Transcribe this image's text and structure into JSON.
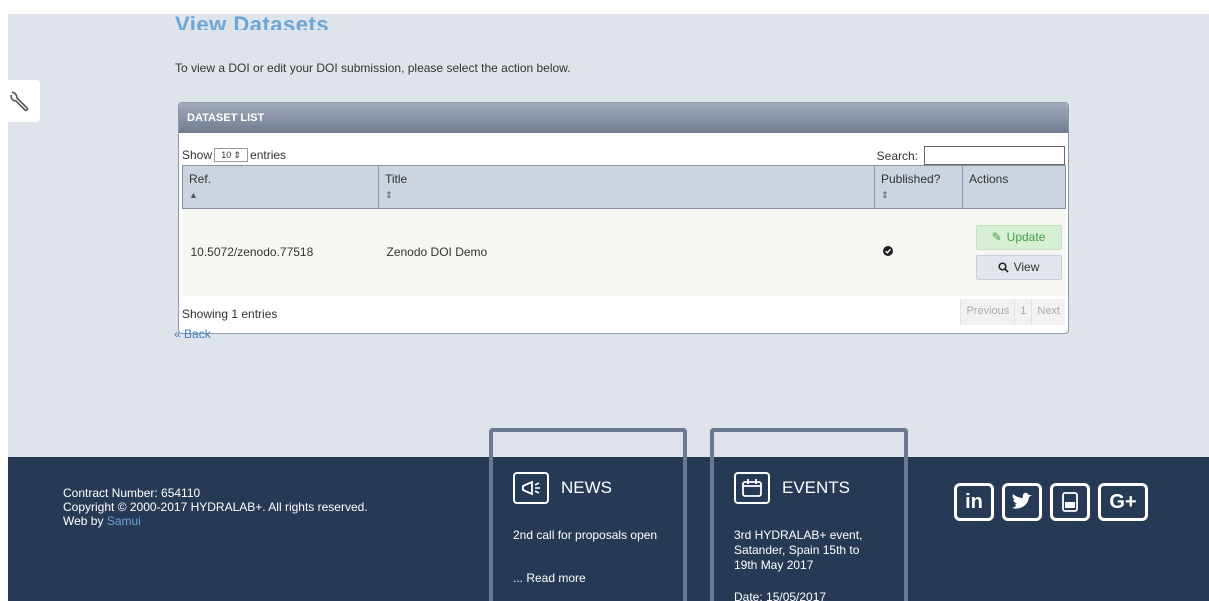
{
  "page": {
    "title": "View Datasets",
    "intro": "To view a DOI or edit your DOI submission, please select the action below."
  },
  "panel": {
    "title": "DATASET LIST",
    "show_label": "Show",
    "entries_label": "entries",
    "length_value": "10",
    "search_label": "Search:",
    "search_value": ""
  },
  "table": {
    "columns": [
      "Ref.",
      "Title",
      "Published?",
      "Actions"
    ],
    "rows": [
      {
        "ref": "10.5072/zenodo.77518",
        "title": "Zenodo DOI Demo",
        "published": true,
        "update_label": "Update",
        "view_label": "View"
      }
    ]
  },
  "info": "Showing 1 entries",
  "pagination": {
    "previous": "Previous",
    "current": "1",
    "next": "Next"
  },
  "back": "Back",
  "footer": {
    "contract": "Contract Number: 654110",
    "copyright": "Copyright © 2000-2017 HYDRALAB+. All rights reserved.",
    "web_by_prefix": "Web by",
    "web_by_link": "Samui",
    "news": {
      "title": "NEWS",
      "text": "2nd call for proposals open",
      "more": "... Read more"
    },
    "events": {
      "title": "EVENTS",
      "text": "3rd HYDRALAB+ event, Satander, Spain 15th to 19th May 2017",
      "date": "Date: 15/05/2017"
    },
    "social": [
      "in",
      "G+"
    ]
  },
  "colors": {
    "page_bg": "#dfe3ea",
    "footer_bg": "#263a55",
    "title_blue": "#6aa6d6",
    "update_green": "#3ea04a"
  },
  "icons": {
    "tool": "wrench-icon",
    "update": "pencil-icon",
    "view": "search-icon",
    "published": "check-circle-icon",
    "news": "megaphone-icon",
    "events": "calendar-icon",
    "social": [
      "linkedin-icon",
      "twitter-icon",
      "youtube-icon",
      "google-plus-icon"
    ]
  }
}
